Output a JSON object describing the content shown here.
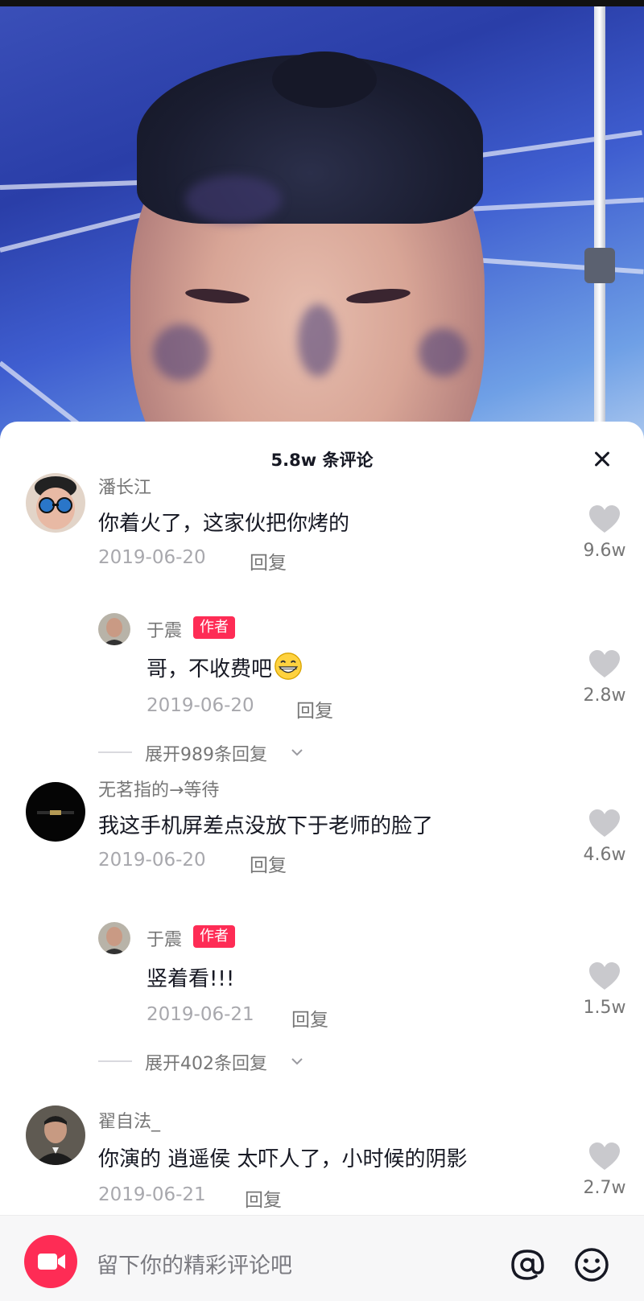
{
  "sheet": {
    "title": "5.8w 条评论"
  },
  "comments": [
    {
      "username": "潘长江",
      "text": "你着火了，这家伙把你烤的",
      "date": "2019-06-20",
      "reply_label": "回复",
      "likes": "9.6w",
      "reply": {
        "username": "于震",
        "badge": "作者",
        "text": "哥，不收费吧",
        "date": "2019-06-20",
        "reply_label": "回复",
        "likes": "2.8w"
      },
      "expand_label": "展开989条回复"
    },
    {
      "username": "无茗指的→等待",
      "text": "我这手机屏差点没放下于老师的脸了",
      "date": "2019-06-20",
      "reply_label": "回复",
      "likes": "4.6w",
      "reply": {
        "username": "于震",
        "badge": "作者",
        "text": "竖着看!!!",
        "date": "2019-06-21",
        "reply_label": "回复",
        "likes": "1.5w"
      },
      "expand_label": "展开402条回复"
    },
    {
      "username": "翟自法_",
      "text": "你演的 逍遥侯 太吓人了，小时候的阴影",
      "date": "2019-06-21",
      "reply_label": "回复",
      "likes": "2.7w"
    }
  ],
  "input": {
    "placeholder": "留下你的精彩评论吧"
  },
  "icons": {
    "close": "close-icon",
    "heart": "heart-icon",
    "camera": "camera-icon",
    "at": "at-icon",
    "emoji": "emoji-icon",
    "grin": "grinning-emoji",
    "chevron": "chevron-down-icon"
  },
  "colors": {
    "accent": "#fe2c55",
    "heart": "#c9c9cd"
  }
}
